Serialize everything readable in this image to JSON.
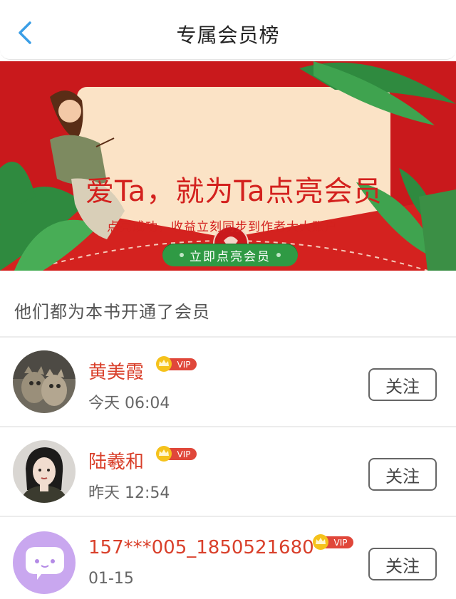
{
  "header": {
    "title": "专属会员榜",
    "back_icon": "chevron-left-icon"
  },
  "banner": {
    "headline": "爱Ta，就为Ta点亮会员",
    "subtitle": "点亮成功，收益立刻同步到作者大大账户",
    "cta_label": "立即点亮会员",
    "colors": {
      "background": "#c9191c",
      "card": "#fbe3c6",
      "accent": "#d3211e",
      "button": "#2f9a44"
    }
  },
  "section": {
    "heading": "他们都为本书开通了会员"
  },
  "members": [
    {
      "name": "黄美霞",
      "vip_label": "VIP",
      "time": "今天 06:04",
      "follow_label": "关注",
      "avatar": "cats-photo"
    },
    {
      "name": "陆羲和",
      "vip_label": "VIP",
      "time": "昨天 12:54",
      "follow_label": "关注",
      "avatar": "woman-photo"
    },
    {
      "name": "157***005_1850521680",
      "vip_label": "VIP",
      "time": "01-15",
      "follow_label": "关注",
      "avatar": "default-chat-avatar"
    }
  ],
  "theme": {
    "name_color": "#d9402b",
    "vip_color": "#e0473a",
    "back_icon_color": "#3a9ee6"
  }
}
